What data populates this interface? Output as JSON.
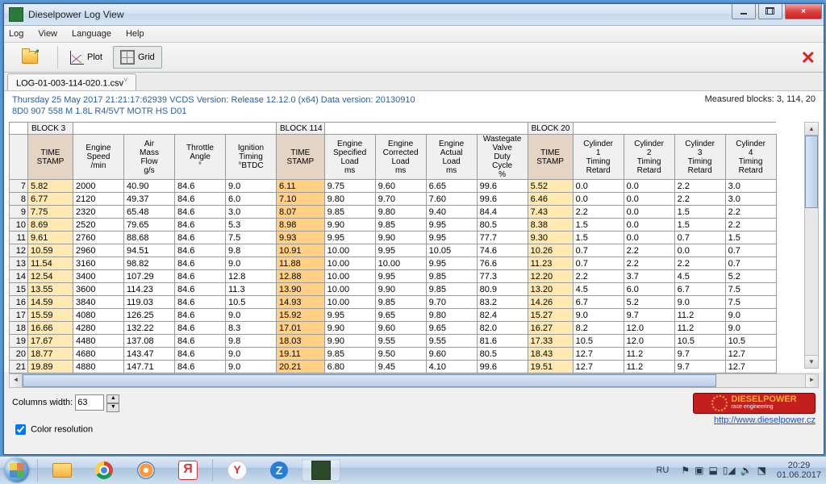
{
  "window": {
    "title": "Dieselpower Log View",
    "icon": "dieselpower-icon"
  },
  "menu": {
    "items": [
      "Log",
      "View",
      "Language",
      "Help"
    ]
  },
  "toolbar": {
    "open": "Open",
    "plot": "Plot",
    "grid": "Grid",
    "close": "Close"
  },
  "filetab": "LOG-01-003-114-020.1.csv",
  "info": {
    "line1": "Thursday 25 May 2017 21:21:17:62939 VCDS Version: Release 12.12.0 (x64) Data version: 20130910",
    "line2": "8D0 907 558 M  1.8L R4/5VT MOTR HS D01",
    "measured": "Measured blocks: 3, 114, 20"
  },
  "block_labels": {
    "b3": "BLOCK 3",
    "b114": "BLOCK 114",
    "b20": "BLOCK 20"
  },
  "columns": [
    "",
    "TIME STAMP",
    "Engine Speed /min",
    "Air Mass Flow g/s",
    "Throttle Angle °",
    "Ignition Timing °BTDC",
    "TIME STAMP",
    "Engine Specified Load ms",
    "Engine Corrected Load ms",
    "Engine Actual Load ms",
    "Wastegate Valve Duty Cycle %",
    "TIME STAMP",
    "Cylinder 1 Timing Retard",
    "Cylinder 2 Timing Retard",
    "Cylinder 3 Timing Retard",
    "Cylinder 4 Timing Retard"
  ],
  "rows": [
    {
      "n": 7,
      "c": [
        "5.82",
        "2000",
        "40.90",
        "84.6",
        "9.0",
        "6.11",
        "9.75",
        "9.60",
        "6.65",
        "99.6",
        "5.52",
        "0.0",
        "0.0",
        "2.2",
        "3.0"
      ]
    },
    {
      "n": 8,
      "c": [
        "6.77",
        "2120",
        "49.37",
        "84.6",
        "6.0",
        "7.10",
        "9.80",
        "9.70",
        "7.60",
        "99.6",
        "6.46",
        "0.0",
        "0.0",
        "2.2",
        "3.0"
      ]
    },
    {
      "n": 9,
      "c": [
        "7.75",
        "2320",
        "65.48",
        "84.6",
        "3.0",
        "8.07",
        "9.85",
        "9.80",
        "9.40",
        "84.4",
        "7.43",
        "2.2",
        "0.0",
        "1.5",
        "2.2"
      ]
    },
    {
      "n": 10,
      "c": [
        "8.69",
        "2520",
        "79.65",
        "84.6",
        "5.3",
        "8.98",
        "9.90",
        "9.85",
        "9.95",
        "80.5",
        "8.38",
        "1.5",
        "0.0",
        "1.5",
        "2.2"
      ]
    },
    {
      "n": 11,
      "c": [
        "9.61",
        "2760",
        "88.68",
        "84.6",
        "7.5",
        "9.93",
        "9.95",
        "9.90",
        "9.95",
        "77.7",
        "9.30",
        "1.5",
        "0.0",
        "0.7",
        "1.5"
      ]
    },
    {
      "n": 12,
      "c": [
        "10.59",
        "2960",
        "94.51",
        "84.6",
        "9.8",
        "10.91",
        "10.00",
        "9.95",
        "10.05",
        "74.6",
        "10.26",
        "0.7",
        "2.2",
        "0.0",
        "0.7"
      ]
    },
    {
      "n": 13,
      "c": [
        "11.54",
        "3160",
        "98.82",
        "84.6",
        "9.0",
        "11.88",
        "10.00",
        "10.00",
        "9.95",
        "76.6",
        "11.23",
        "0.7",
        "2.2",
        "2.2",
        "0.7"
      ]
    },
    {
      "n": 14,
      "c": [
        "12.54",
        "3400",
        "107.29",
        "84.6",
        "12.8",
        "12.88",
        "10.00",
        "9.95",
        "9.85",
        "77.3",
        "12.20",
        "2.2",
        "3.7",
        "4.5",
        "5.2"
      ]
    },
    {
      "n": 15,
      "c": [
        "13.55",
        "3600",
        "114.23",
        "84.6",
        "11.3",
        "13.90",
        "10.00",
        "9.90",
        "9.85",
        "80.9",
        "13.20",
        "4.5",
        "6.0",
        "6.7",
        "7.5"
      ]
    },
    {
      "n": 16,
      "c": [
        "14.59",
        "3840",
        "119.03",
        "84.6",
        "10.5",
        "14.93",
        "10.00",
        "9.85",
        "9.70",
        "83.2",
        "14.26",
        "6.7",
        "5.2",
        "9.0",
        "7.5"
      ]
    },
    {
      "n": 17,
      "c": [
        "15.59",
        "4080",
        "126.25",
        "84.6",
        "9.0",
        "15.92",
        "9.95",
        "9.65",
        "9.80",
        "82.4",
        "15.27",
        "9.0",
        "9.7",
        "11.2",
        "9.0"
      ]
    },
    {
      "n": 18,
      "c": [
        "16.66",
        "4280",
        "132.22",
        "84.6",
        "8.3",
        "17.01",
        "9.90",
        "9.60",
        "9.65",
        "82.0",
        "16.27",
        "8.2",
        "12.0",
        "11.2",
        "9.0"
      ]
    },
    {
      "n": 19,
      "c": [
        "17.67",
        "4480",
        "137.08",
        "84.6",
        "9.8",
        "18.03",
        "9.90",
        "9.55",
        "9.55",
        "81.6",
        "17.33",
        "10.5",
        "12.0",
        "10.5",
        "10.5"
      ]
    },
    {
      "n": 20,
      "c": [
        "18.77",
        "4680",
        "143.47",
        "84.6",
        "9.0",
        "19.11",
        "9.85",
        "9.50",
        "9.60",
        "80.5",
        "18.43",
        "12.7",
        "11.2",
        "9.7",
        "12.7"
      ]
    },
    {
      "n": 21,
      "c": [
        "19.89",
        "4880",
        "147.71",
        "84.6",
        "9.0",
        "20.21",
        "6.80",
        "9.45",
        "4.10",
        "99.6",
        "19.51",
        "12.7",
        "11.2",
        "9.7",
        "12.7"
      ]
    }
  ],
  "bottom": {
    "colwidth_label": "Columns width:",
    "colwidth_value": "63",
    "colorres": "Color resolution",
    "link": "http://www.dieselpower.cz",
    "logo_top": "DIESELPOWER",
    "logo_sub": "race engineering"
  },
  "taskbar": {
    "lang": "RU",
    "time": "20:29",
    "date": "01.06.2017"
  }
}
